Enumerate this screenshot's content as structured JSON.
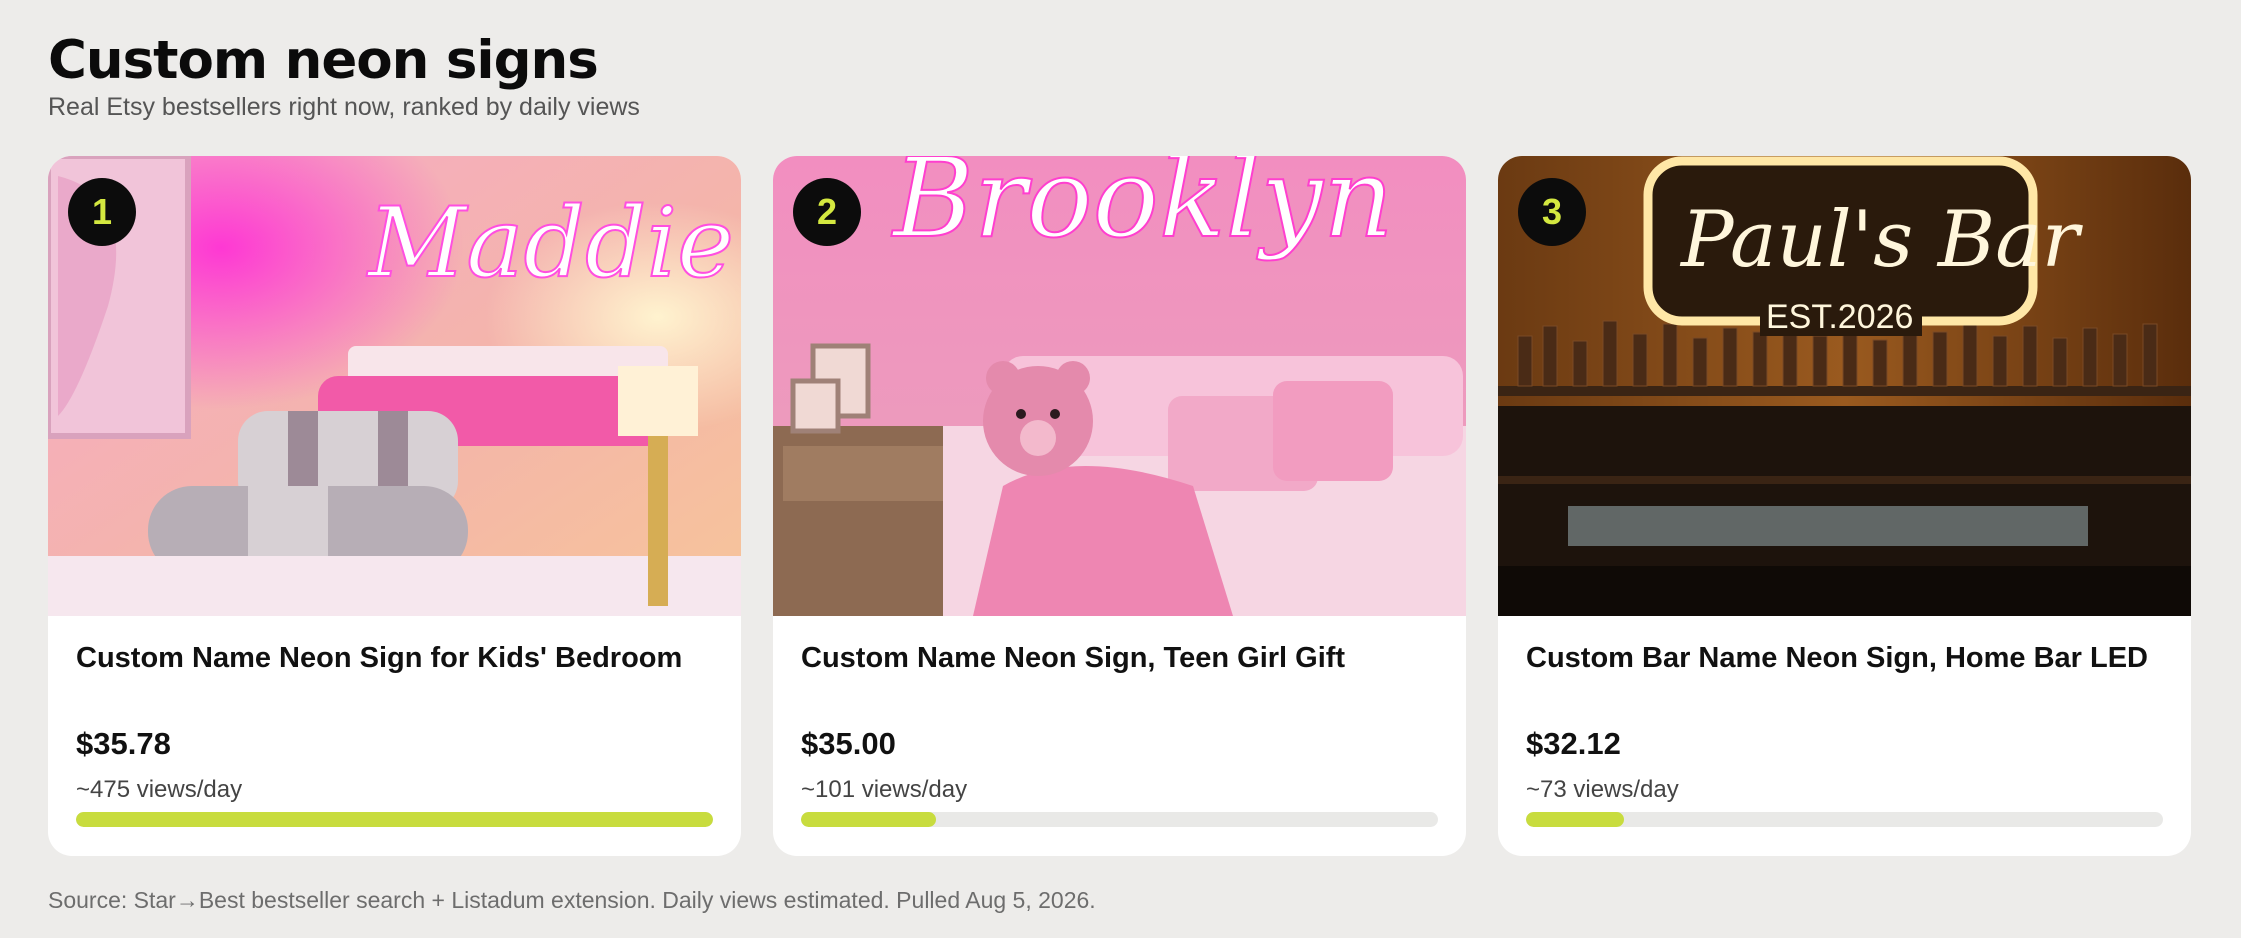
{
  "header": {
    "title": "Custom neon signs",
    "subtitle": "Real Etsy bestsellers right now, ranked by daily views"
  },
  "accent_color": "#c8dc3e",
  "rank_text_color": "#d4e840",
  "listings": [
    {
      "rank": "1",
      "name": "Custom Name Neon Sign for Kids' Bedroom",
      "price": "$35.78",
      "views": "~475 views/day",
      "views_value": 475,
      "image_sign_text": "Maddie",
      "image": "pink-bedroom-neon-photo"
    },
    {
      "rank": "2",
      "name": "Custom Name Neon Sign, Teen Girl Gift",
      "price": "$35.00",
      "views": "~101 views/day",
      "views_value": 101,
      "image_sign_text": "Brooklyn",
      "image": "pink-teen-room-teddy-bear-photo"
    },
    {
      "rank": "3",
      "name": "Custom Bar Name Neon Sign, Home Bar LED",
      "price": "$32.12",
      "views": "~73 views/day",
      "views_value": 73,
      "image_sign_text": "Paul's Bar",
      "image_sign_subtext": "EST.2026",
      "image": "home-bar-shelves-neon-photo"
    }
  ],
  "views_scale_max": 475,
  "footer": {
    "source": "Source: Star→Best bestseller search + Listadum extension. Daily views estimated. Pulled Aug 5, 2026."
  }
}
